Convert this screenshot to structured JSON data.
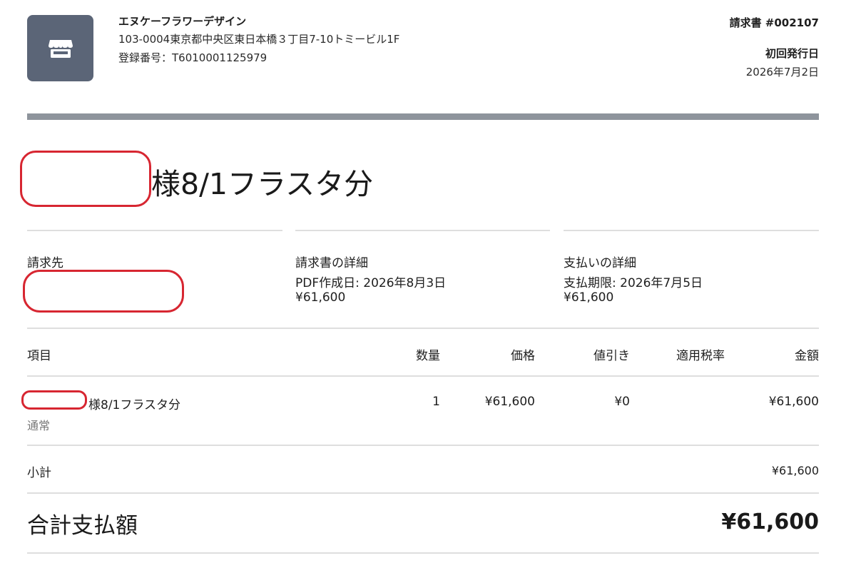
{
  "company": {
    "name": "エヌケーフラワーデザイン",
    "address": "103-0004東京都中央区東日本橋３丁目7-10トミービル1F",
    "registration": "登録番号：T6010001125979",
    "logo_icon": "store-icon"
  },
  "invoice": {
    "number": "請求書 #002107",
    "issue_label": "初回発行日",
    "issue_date": "2026年7月2日"
  },
  "title": "様8/1フラスタ分",
  "columns": {
    "bill_to": {
      "heading": "請求先"
    },
    "details": {
      "heading": "請求書の詳細",
      "pdf_created": "PDF作成日: 2026年8月3日",
      "amount": "¥61,600"
    },
    "payment": {
      "heading": "支払いの詳細",
      "due": "支払期限: 2026年7月5日",
      "amount": "¥61,600"
    }
  },
  "table": {
    "headers": {
      "item": "項目",
      "qty": "数量",
      "price": "価格",
      "discount": "値引き",
      "tax": "適用税率",
      "amount": "金額"
    },
    "rows": [
      {
        "item": "様8/1フラスタ分",
        "sub": "通常",
        "qty": "1",
        "price": "¥61,600",
        "discount": "¥0",
        "tax": "",
        "amount": "¥61,600"
      }
    ]
  },
  "subtotal": {
    "label": "小計",
    "value": "¥61,600"
  },
  "total": {
    "label": "合計支払額",
    "value": "¥61,600"
  },
  "colors": {
    "logo_bg": "#5b6577",
    "bar": "#8e949c",
    "redaction": "#d72631",
    "rule": "#dedede"
  }
}
